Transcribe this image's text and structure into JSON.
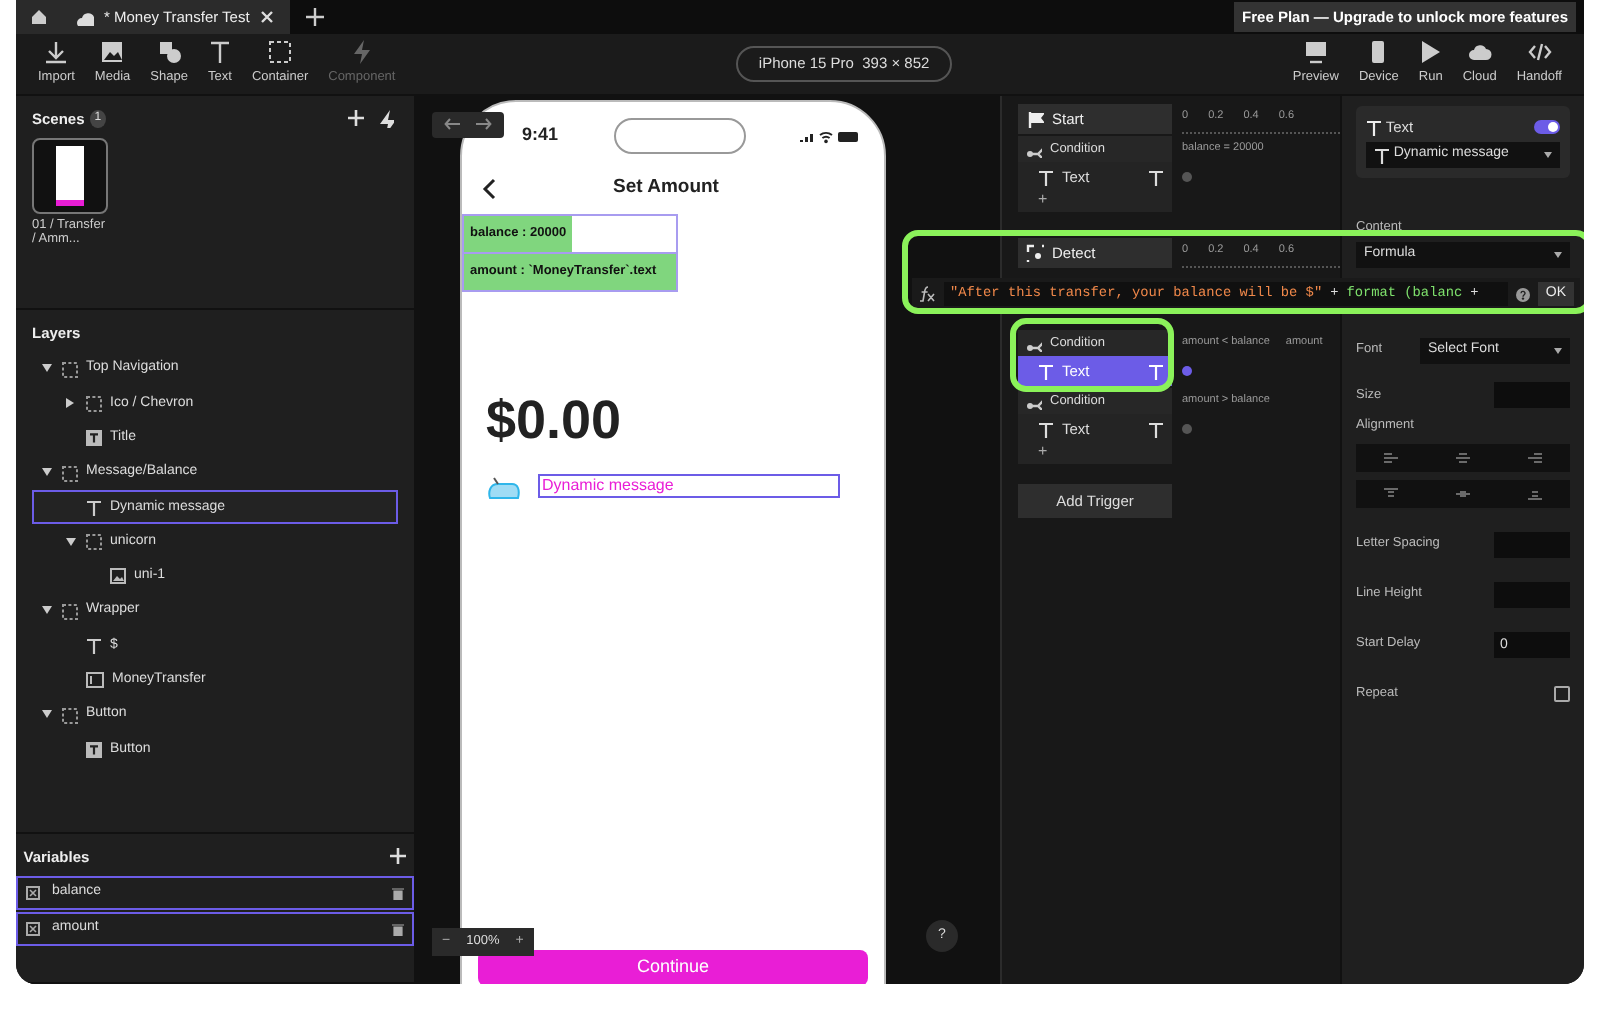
{
  "tabs": [
    {
      "label": "* Money Transfer Test",
      "selected": true
    }
  ],
  "banner": "Free Plan — Upgrade to unlock more features",
  "toolbar": {
    "left": [
      {
        "label": "Import",
        "disabled": false
      },
      {
        "label": "Media",
        "disabled": false
      },
      {
        "label": "Shape",
        "disabled": false
      },
      {
        "label": "Text",
        "disabled": false
      },
      {
        "label": "Container",
        "disabled": false
      },
      {
        "label": "Component",
        "disabled": true
      }
    ],
    "device": "iPhone 15 Pro  393 × 852",
    "right": [
      {
        "label": "Preview",
        "disabled": false
      },
      {
        "label": "Device",
        "disabled": false
      },
      {
        "label": "Run",
        "disabled": false
      },
      {
        "label": "Cloud",
        "disabled": false
      },
      {
        "label": "Handoff",
        "disabled": false
      }
    ]
  },
  "scenes": {
    "title": "Scenes",
    "count": "1",
    "items": [
      {
        "label": "01 / Transfer / Amm...",
        "selected": true
      }
    ]
  },
  "layers": {
    "title": "Layers",
    "items": [
      {
        "label": "Top Navigation",
        "kind": "group",
        "expanded": true,
        "selected": false,
        "children": [
          {
            "label": "Ico / Chevron",
            "kind": "group",
            "expanded": false,
            "selected": false
          },
          {
            "label": "Title",
            "kind": "textbox",
            "selected": false
          }
        ]
      },
      {
        "label": "Message/Balance",
        "kind": "group",
        "expanded": true,
        "selected": false,
        "children": [
          {
            "label": "Dynamic message",
            "kind": "text",
            "selected": true
          },
          {
            "label": "unicorn",
            "kind": "group",
            "expanded": true,
            "selected": false,
            "children": [
              {
                "label": "uni-1",
                "kind": "image",
                "selected": false
              }
            ]
          }
        ]
      },
      {
        "label": "Wrapper",
        "kind": "group",
        "expanded": true,
        "selected": false,
        "children": [
          {
            "label": "$",
            "kind": "text",
            "selected": false
          },
          {
            "label": "MoneyTransfer",
            "kind": "input",
            "selected": false
          }
        ]
      },
      {
        "label": "Button",
        "kind": "group",
        "expanded": true,
        "selected": false,
        "children": [
          {
            "label": "Button",
            "kind": "textbox",
            "selected": false
          }
        ]
      }
    ]
  },
  "variables": {
    "title": "Variables",
    "items": [
      {
        "name": "balance",
        "selected": true
      },
      {
        "name": "amount",
        "selected": true
      }
    ]
  },
  "canvas": {
    "zoom_out": "−",
    "zoom": "100%",
    "zoom_in": "+",
    "help": "?",
    "phone": {
      "time": "9:41",
      "title": "Set Amount",
      "debug": [
        "balance : 20000",
        "amount : `MoneyTransfer`.text"
      ],
      "amount": "$0.00",
      "message": "Dynamic message",
      "button": "Continue"
    }
  },
  "triggers": [
    {
      "name": "Start",
      "ticks": [
        "0",
        "0.2",
        "0.4",
        "0.6"
      ],
      "add": "+",
      "conditions": [
        {
          "label": "Condition",
          "exprs": [
            "balance = 20000"
          ],
          "actions": [
            {
              "label": "Text",
              "selected": false
            }
          ]
        }
      ]
    },
    {
      "name": "Detect",
      "add": "+",
      "ticks": [
        "0",
        "0.2",
        "0.4",
        "0.6"
      ],
      "conditions": [
        {
          "label": "Condition",
          "exprs": [
            "amount < balance",
            "amount"
          ],
          "actions": [
            {
              "label": "Text",
              "selected": true
            }
          ]
        },
        {
          "label": "Condition",
          "exprs": [
            "amount > balance"
          ],
          "actions": [
            {
              "label": "Text",
              "selected": false
            }
          ]
        }
      ]
    }
  ],
  "add_trigger": "Add Trigger",
  "props": {
    "component": "Text",
    "enabled": true,
    "target": "Dynamic message",
    "content_label": "Content",
    "content_type": "Formula",
    "formula": [
      {
        "kind": "string",
        "text": "\"After this transfer, your balance will be $\""
      },
      {
        "kind": "operator",
        "text": "+"
      },
      {
        "kind": "function",
        "text": "format (balanc"
      },
      {
        "kind": "operator",
        "text": "+"
      }
    ],
    "ok": "OK",
    "font_label": "Font",
    "font": "Select Font",
    "size_label": "Size",
    "alignment_label": "Alignment",
    "fields": [
      {
        "label": "Letter Spacing"
      },
      {
        "label": "Line Height"
      },
      {
        "label": "Start Delay",
        "value": "0"
      }
    ],
    "repeat_label": "Repeat",
    "repeat": false
  }
}
